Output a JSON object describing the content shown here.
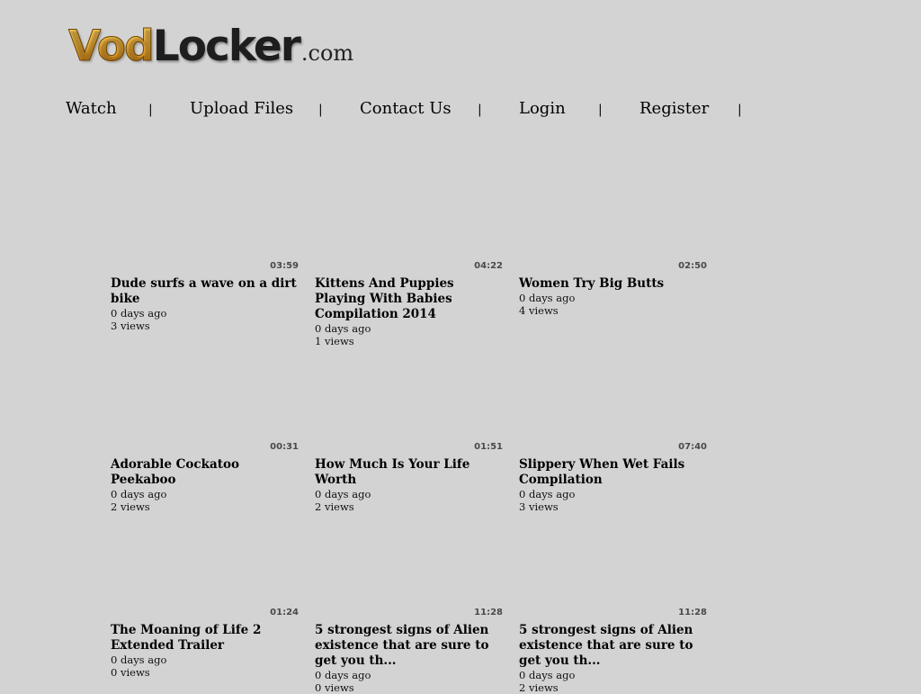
{
  "logo": {
    "vod": "Vod",
    "locker": "Locker",
    "com": ".com"
  },
  "nav": [
    {
      "label": "Watch"
    },
    {
      "label": "Upload Files"
    },
    {
      "label": "Contact Us"
    },
    {
      "label": "Login"
    },
    {
      "label": "Register"
    }
  ],
  "separator": "|",
  "videos": [
    {
      "duration": "03:59",
      "title": "Dude surfs a wave on a dirt bike",
      "age": "0 days ago",
      "views": "3 views"
    },
    {
      "duration": "04:22",
      "title": "Kittens And Puppies Playing With Babies Compilation 2014",
      "age": "0 days ago",
      "views": "1 views"
    },
    {
      "duration": "02:50",
      "title": "Women Try Big Butts",
      "age": "0 days ago",
      "views": "4 views"
    },
    {
      "duration": "00:31",
      "title": "Adorable Cockatoo Peekaboo",
      "age": "0 days ago",
      "views": "2 views"
    },
    {
      "duration": "01:51",
      "title": "How Much Is Your Life Worth",
      "age": "0 days ago",
      "views": "2 views"
    },
    {
      "duration": "07:40",
      "title": "Slippery When Wet Fails Compilation",
      "age": "0 days ago",
      "views": "3 views"
    },
    {
      "duration": "01:24",
      "title": "The Moaning of Life 2 Extended Trailer",
      "age": "0 days ago",
      "views": "0 views"
    },
    {
      "duration": "11:28",
      "title": "5 strongest signs of Alien existence that are sure to get you th...",
      "age": "0 days ago",
      "views": "0 views"
    },
    {
      "duration": "11:28",
      "title": "5 strongest signs of Alien existence that are sure to get you th...",
      "age": "0 days ago",
      "views": "2 views"
    }
  ]
}
